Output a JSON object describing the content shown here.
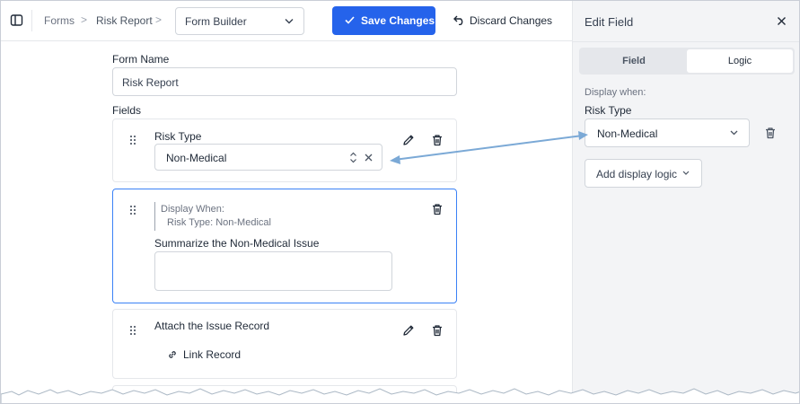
{
  "breadcrumb": {
    "items": [
      "Forms",
      "Risk Report"
    ],
    "separator": ">"
  },
  "header": {
    "view_select": "Form Builder",
    "save_label": "Save Changes",
    "discard_label": "Discard Changes"
  },
  "form": {
    "name_label": "Form Name",
    "name_value": "Risk Report",
    "fields_label": "Fields",
    "fields": [
      {
        "title": "Risk Type",
        "value": "Non-Medical"
      },
      {
        "condition_label": "Display When:",
        "condition": "Risk Type: Non-Medical",
        "title": "Summarize the Non-Medical Issue",
        "value": ""
      },
      {
        "title": "Attach the Issue Record",
        "link_label": "Link Record"
      }
    ]
  },
  "panel": {
    "title": "Edit Field",
    "tabs": [
      {
        "label": "Field",
        "active": false
      },
      {
        "label": "Logic",
        "active": true
      }
    ],
    "display_when_label": "Display when:",
    "field_label": "Risk Type",
    "field_value": "Non-Medical",
    "add_logic_label": "Add display logic"
  },
  "colors": {
    "accent": "#2563eb",
    "selected_border": "#3b82f6",
    "annotation_arrow": "#7ba9d6",
    "panel_bg": "#f3f4f6"
  },
  "icons": {
    "sidebar_toggle": "sidebar-toggle-icon",
    "chevron": "chevron-down-icon",
    "check": "check-icon",
    "undo": "undo-icon",
    "drag": "drag-handle-icon",
    "edit": "pencil-icon",
    "delete": "trash-icon",
    "link": "link-icon",
    "close": "close-icon"
  }
}
